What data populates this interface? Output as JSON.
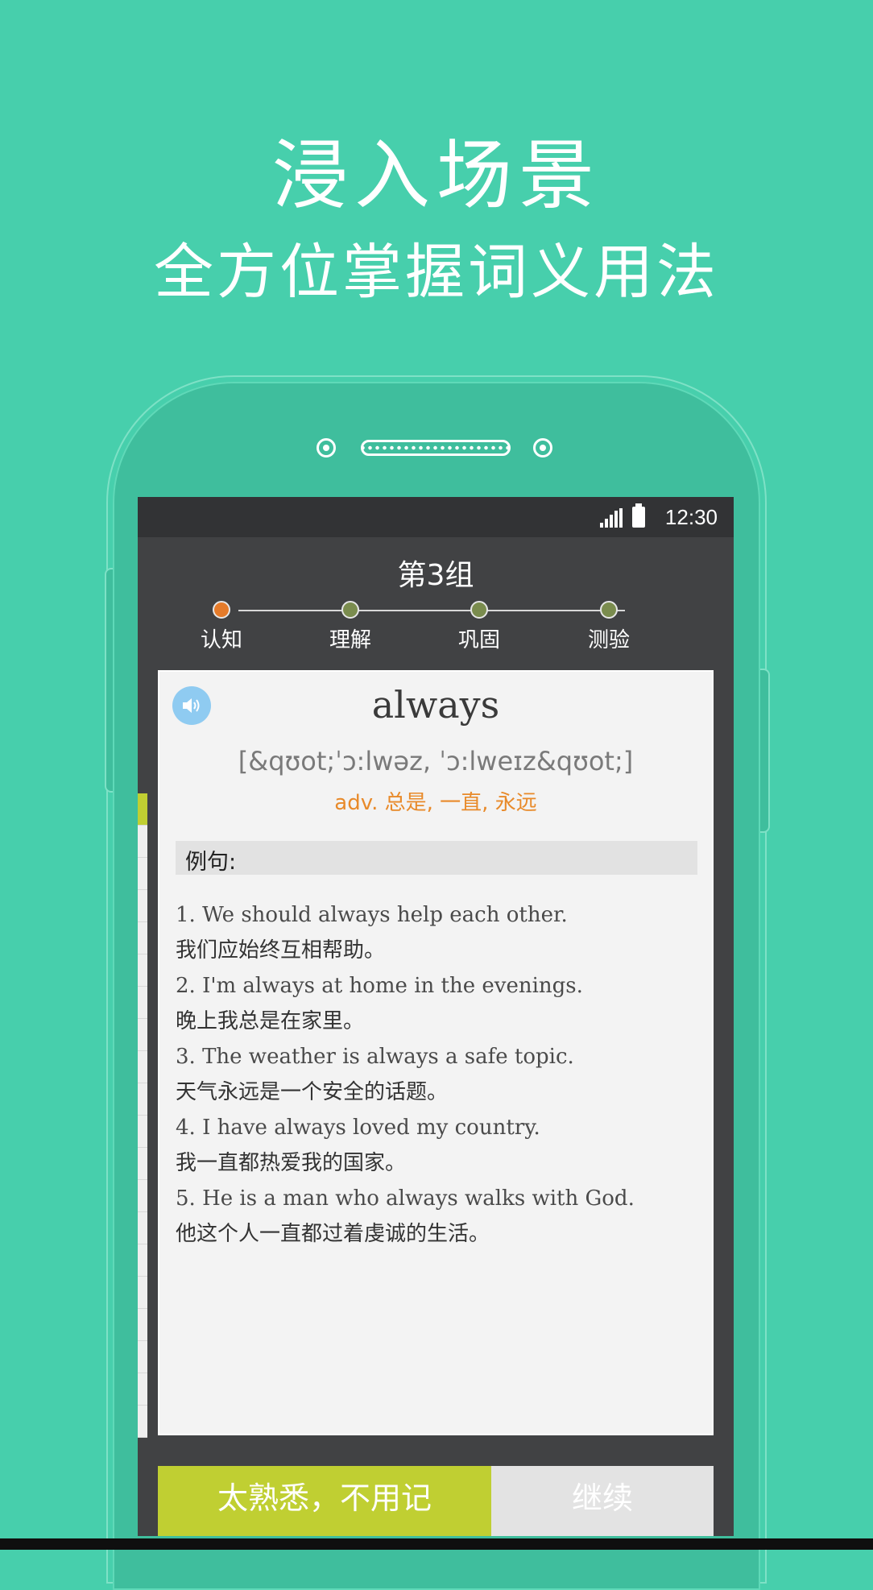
{
  "promo": {
    "title": "浸入场景",
    "subtitle": "全方位掌握词义用法"
  },
  "status_bar": {
    "time": "12:30",
    "icons": [
      "signal-icon",
      "battery-icon"
    ]
  },
  "header": {
    "group_title": "第3组",
    "steps": [
      {
        "label": "认知",
        "color": "#e57b2a"
      },
      {
        "label": "理解",
        "color": "#7a8c4e"
      },
      {
        "label": "巩固",
        "color": "#7a8c4e"
      },
      {
        "label": "测验",
        "color": "#7a8c4e"
      }
    ]
  },
  "card": {
    "audio_icon": "speaker-icon",
    "word": "always",
    "phonetic": "[&qʊot;ˈɔ:lwəz, ˈɔ:lweɪz&qʊot;]",
    "meaning": "adv. 总是, 一直, 永远",
    "example_header": "例句:",
    "examples": [
      {
        "en": "1. We should always help each other.",
        "zh": "我们应始终互相帮助。"
      },
      {
        "en": "2. I'm always at home in the evenings.",
        "zh": "晚上我总是在家里。"
      },
      {
        "en": "3. The weather is always a safe topic.",
        "zh": "天气永远是一个安全的话题。"
      },
      {
        "en": "4. I have always loved my country.",
        "zh": "我一直都热爱我的国家。"
      },
      {
        "en": "5. He is a man who always walks with God.",
        "zh": "他这个人一直都过着虔诚的生活。"
      }
    ]
  },
  "actions": {
    "familiar_label": "太熟悉，不用记",
    "continue_label": "继续",
    "familiar_color": "#c0cf32",
    "continue_color": "#e3e3e3"
  },
  "colors": {
    "background": "#47cfac",
    "screen": "#414244",
    "accent_orange": "#e88a2a"
  }
}
